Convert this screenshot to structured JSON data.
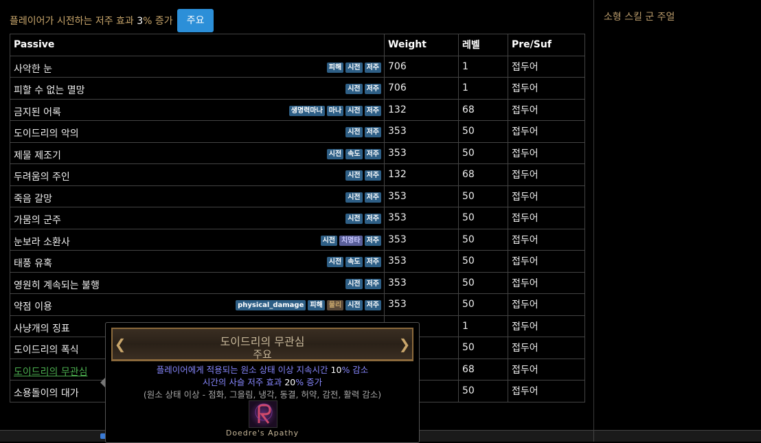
{
  "header": {
    "title_pre": "플레이어가 시전하는 저주 효과 ",
    "title_num": "3",
    "title_post": "% 증가",
    "button_label": "주요"
  },
  "table": {
    "columns": [
      "Passive",
      "Weight",
      "레벨",
      "Pre/Suf"
    ],
    "rows": [
      {
        "name": "사악한 눈",
        "tags": [
          {
            "t": "피해"
          },
          {
            "t": "시전"
          },
          {
            "t": "저주"
          }
        ],
        "weight": "706",
        "level": "1",
        "presuf": "접두어"
      },
      {
        "name": "피할 수 없는 멸망",
        "tags": [
          {
            "t": "시전"
          },
          {
            "t": "저주"
          }
        ],
        "weight": "706",
        "level": "1",
        "presuf": "접두어"
      },
      {
        "name": "금지된 어록",
        "tags": [
          {
            "t": "생명력마나"
          },
          {
            "t": "마나"
          },
          {
            "t": "시전"
          },
          {
            "t": "저주"
          }
        ],
        "weight": "132",
        "level": "68",
        "presuf": "접두어"
      },
      {
        "name": "도이드리의 악의",
        "tags": [
          {
            "t": "시전"
          },
          {
            "t": "저주"
          }
        ],
        "weight": "353",
        "level": "50",
        "presuf": "접두어"
      },
      {
        "name": "제물 제조기",
        "tags": [
          {
            "t": "시전"
          },
          {
            "t": "속도"
          },
          {
            "t": "저주"
          }
        ],
        "weight": "353",
        "level": "50",
        "presuf": "접두어"
      },
      {
        "name": "두려움의 주인",
        "tags": [
          {
            "t": "시전"
          },
          {
            "t": "저주"
          }
        ],
        "weight": "132",
        "level": "68",
        "presuf": "접두어"
      },
      {
        "name": "죽음 갈망",
        "tags": [
          {
            "t": "시전"
          },
          {
            "t": "저주"
          }
        ],
        "weight": "353",
        "level": "50",
        "presuf": "접두어"
      },
      {
        "name": "가뭄의 군주",
        "tags": [
          {
            "t": "시전"
          },
          {
            "t": "저주"
          }
        ],
        "weight": "353",
        "level": "50",
        "presuf": "접두어"
      },
      {
        "name": "눈보라 소환사",
        "tags": [
          {
            "t": "시전"
          },
          {
            "t": "치명타",
            "c": "purple"
          },
          {
            "t": "저주"
          }
        ],
        "weight": "353",
        "level": "50",
        "presuf": "접두어"
      },
      {
        "name": "태풍 유혹",
        "tags": [
          {
            "t": "시전"
          },
          {
            "t": "속도"
          },
          {
            "t": "저주"
          }
        ],
        "weight": "353",
        "level": "50",
        "presuf": "접두어"
      },
      {
        "name": "영원히 계속되는 불행",
        "tags": [
          {
            "t": "시전"
          },
          {
            "t": "저주"
          }
        ],
        "weight": "353",
        "level": "50",
        "presuf": "접두어"
      },
      {
        "name": "약점 이용",
        "tags": [
          {
            "t": "physical_damage"
          },
          {
            "t": "피해"
          },
          {
            "t": "물리",
            "c": "brown"
          },
          {
            "t": "시전"
          },
          {
            "t": "저주"
          }
        ],
        "weight": "353",
        "level": "50",
        "presuf": "접두어"
      },
      {
        "name": "사냥개의 징표",
        "tags": [],
        "weight": "",
        "level": "1",
        "presuf": "접두어"
      },
      {
        "name": "도이드리의 폭식",
        "tags": [],
        "weight": "",
        "level": "50",
        "presuf": "접두어"
      },
      {
        "name": "도이드리의 무관심",
        "link": true,
        "tags": [],
        "weight": "",
        "level": "68",
        "presuf": "접두어"
      },
      {
        "name": "소용돌이의 대가",
        "tags": [],
        "weight": "",
        "level": "50",
        "presuf": "접두어"
      }
    ]
  },
  "tooltip": {
    "name": "도이드리의 무관심",
    "type": "주요",
    "mod1_pre": "플레이어에게 적용되는 원소 상태 이상 지속시간 ",
    "mod1_val": "10",
    "mod1_post": "% 감소",
    "mod2_pre": "시간의 사슬 저주 효과 ",
    "mod2_val": "20",
    "mod2_post": "% 증가",
    "reminder": "(원소 상태 이상 - 점화, 그을림, 냉각, 동결, 허약, 감전, 활력 감소)",
    "icon": "doedre-apathy-icon",
    "caption": "Doedre's Apathy"
  },
  "side": {
    "label": "소형 스킬 군 주얼"
  },
  "colors": {
    "accent": "#2c8fd8",
    "tag": "#2e5f86",
    "passive_text": "#b89a6a",
    "link": "#4caf50",
    "mod_text": "#8888ff"
  }
}
